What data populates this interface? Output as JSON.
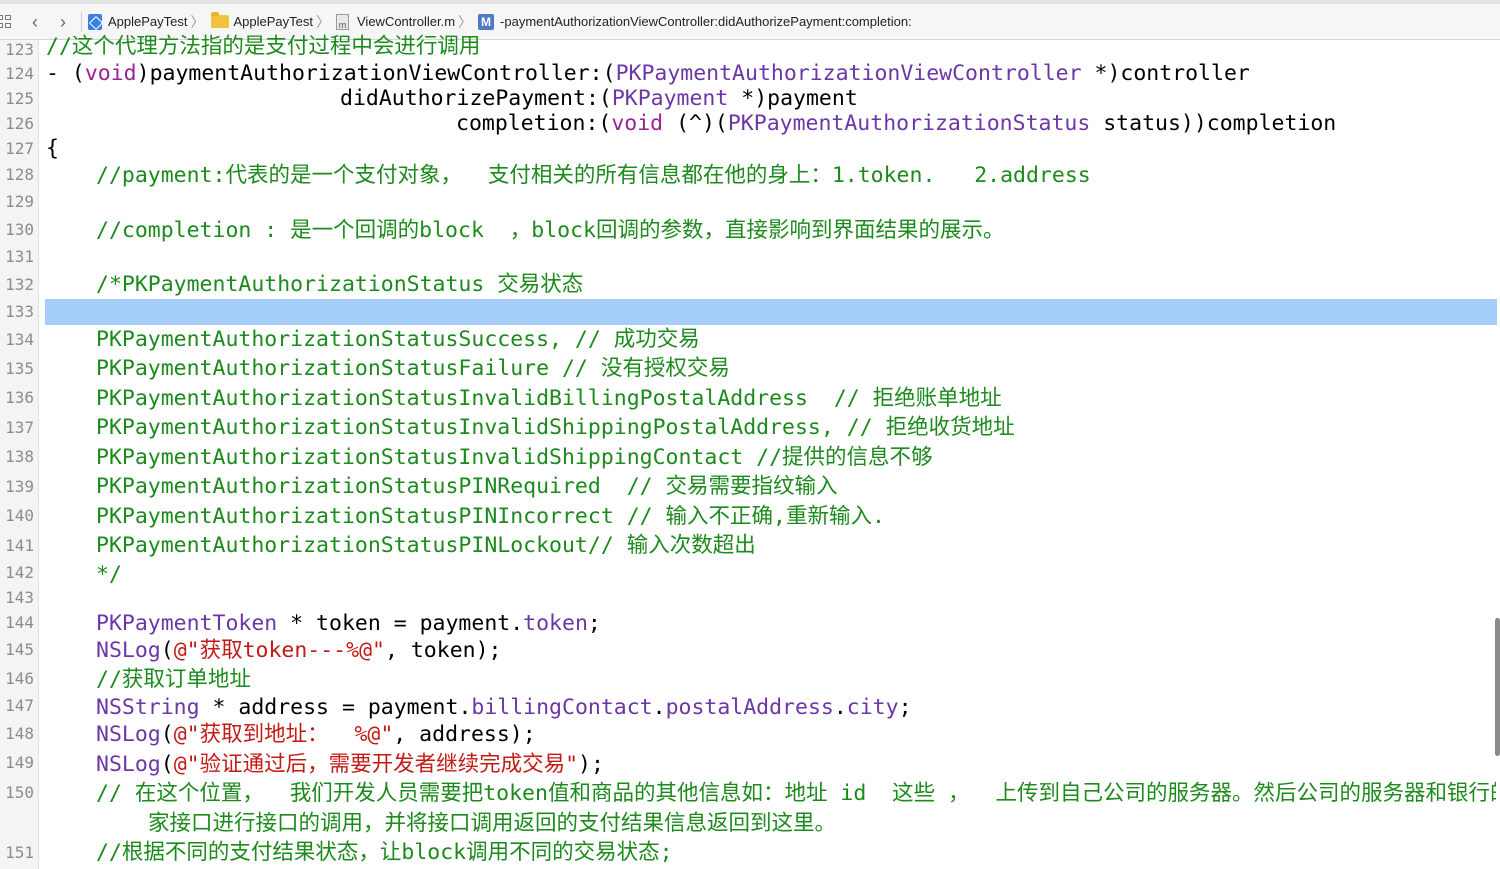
{
  "jumpbar": {
    "items": [
      "ApplePayTest",
      "ApplePayTest",
      "ViewController.m",
      "-paymentAuthorizationViewController:didAuthorizePayment:completion:"
    ]
  },
  "gutter": {
    "lines": [
      "123",
      "124",
      "125",
      "126",
      "127",
      "128",
      "129",
      "130",
      "131",
      "132",
      "133",
      "134",
      "135",
      "136",
      "137",
      "138",
      "139",
      "140",
      "141",
      "142",
      "143",
      "144",
      "145",
      "146",
      "147",
      "148",
      "149",
      "150",
      "151"
    ]
  },
  "code": {
    "l123": "//这个代理方法指的是支付过程中会进行调用",
    "l124": [
      "- (",
      "void",
      ")paymentAuthorizationViewController:(",
      "PKPaymentAuthorizationViewController",
      " *)controller"
    ],
    "l125": [
      "didAuthorizePayment:(",
      "PKPayment",
      " *)payment"
    ],
    "l126": [
      "completion:(",
      "void",
      " (^)(",
      "PKPaymentAuthorizationStatus",
      " status))completion"
    ],
    "l127": "{",
    "l128": "//payment:代表的是一个支付对象，  支付相关的所有信息都在他的身上：1.token.   2.address",
    "l130": "//completion : 是一个回调的block  ，block回调的参数，直接影响到界面结果的展示。",
    "l132": "/*PKPaymentAuthorizationStatus 交易状态",
    "l134": "PKPaymentAuthorizationStatusSuccess, // 成功交易",
    "l135": "PKPaymentAuthorizationStatusFailure // 没有授权交易",
    "l136": "PKPaymentAuthorizationStatusInvalidBillingPostalAddress  // 拒绝账单地址",
    "l137": "PKPaymentAuthorizationStatusInvalidShippingPostalAddress, // 拒绝收货地址",
    "l138": "PKPaymentAuthorizationStatusInvalidShippingContact //提供的信息不够",
    "l139": "PKPaymentAuthorizationStatusPINRequired  // 交易需要指纹输入",
    "l140": "PKPaymentAuthorizationStatusPINIncorrect // 输入不正确,重新输入.",
    "l141": "PKPaymentAuthorizationStatusPINLockout// 输入次数超出",
    "l142": "*/",
    "l144": [
      "PKPaymentToken",
      " * token = payment.",
      "token",
      ";"
    ],
    "l145": [
      "NSLog",
      "(",
      "@\"获取token---%@\"",
      ", token);"
    ],
    "l146": "//获取订单地址",
    "l147": [
      "NSString",
      " * address = payment.",
      "billingContact",
      ".",
      "postalAddress",
      ".",
      "city",
      ";"
    ],
    "l148": [
      "NSLog",
      "(",
      "@\"获取到地址：  %@\"",
      ", address);"
    ],
    "l149": [
      "NSLog",
      "(",
      "@\"验证通过后，需要开发者继续完成交易\"",
      ");"
    ],
    "l150a": "// 在这个位置，  我们开发人员需要把token值和商品的其他信息如：地址 id  这些 ，  上传到自己公司的服务器。然后公司的服务器和银行的商",
    "l150b": "家接口进行接口的调用，并将接口调用返回的支付结果信息返回到这里。",
    "l151": "//根据不同的支付结果状态，让block调用不同的交易状态;"
  }
}
